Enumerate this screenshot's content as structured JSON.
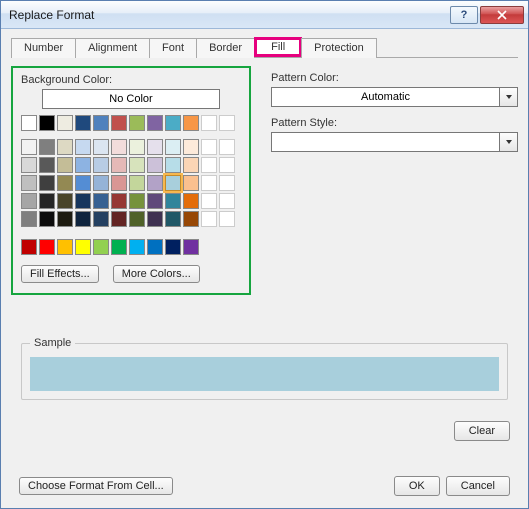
{
  "title": "Replace Format",
  "tabs": [
    "Number",
    "Alignment",
    "Font",
    "Border",
    "Fill",
    "Protection"
  ],
  "active_tab": "Fill",
  "left": {
    "bg_label": "Background Color:",
    "no_color": "No Color",
    "fill_effects": "Fill Effects...",
    "more_colors": "More Colors..."
  },
  "right": {
    "pattern_color_label": "Pattern Color:",
    "pattern_color_value": "Automatic",
    "pattern_style_label": "Pattern Style:",
    "pattern_style_value": ""
  },
  "sample_label": "Sample",
  "sample_color": "#a8cfdc",
  "buttons": {
    "clear": "Clear",
    "choose": "Choose Format From Cell...",
    "ok": "OK",
    "cancel": "Cancel"
  },
  "theme_row": [
    "#ffffff",
    "#000000",
    "#eeece1",
    "#1f497d",
    "#4f81bd",
    "#c0504d",
    "#9bbb59",
    "#8064a2",
    "#4bacc6",
    "#f79646"
  ],
  "tint_rows": [
    [
      "#f2f2f2",
      "#7f7f7f",
      "#ddd9c3",
      "#c6d9f0",
      "#dbe5f1",
      "#f2dcdb",
      "#ebf1dd",
      "#e5e0ec",
      "#dbeef3",
      "#fdeada"
    ],
    [
      "#d8d8d8",
      "#595959",
      "#c4bd97",
      "#8db3e2",
      "#b8cce4",
      "#e5b9b7",
      "#d7e3bc",
      "#ccc1d9",
      "#b7dde8",
      "#fbd5b5"
    ],
    [
      "#bfbfbf",
      "#3f3f3f",
      "#938953",
      "#548dd4",
      "#95b3d7",
      "#d99694",
      "#c3d69b",
      "#b2a2c7",
      "#a8cfdc",
      "#fac08f"
    ],
    [
      "#a5a5a5",
      "#262626",
      "#494429",
      "#17365d",
      "#366092",
      "#953734",
      "#76923c",
      "#5f497a",
      "#31859b",
      "#e36c09"
    ],
    [
      "#7f7f7f",
      "#0c0c0c",
      "#1d1b10",
      "#0f243e",
      "#244061",
      "#632423",
      "#4f6128",
      "#3f3151",
      "#205867",
      "#974806"
    ]
  ],
  "std_row": [
    "#c00000",
    "#ff0000",
    "#ffc000",
    "#ffff00",
    "#92d050",
    "#00b050",
    "#00b0f0",
    "#0070c0",
    "#002060",
    "#7030a0"
  ],
  "selected_color": "#a8cfdc"
}
